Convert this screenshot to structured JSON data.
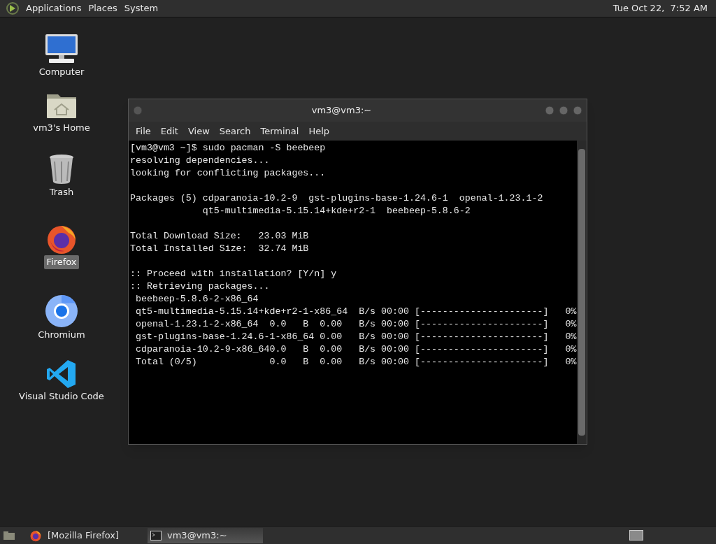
{
  "top_panel": {
    "menus": [
      "Applications",
      "Places",
      "System"
    ],
    "clock": "Tue Oct 22,  7:52 AM"
  },
  "desktop_icons": [
    {
      "kind": "computer",
      "label": "Computer",
      "selected": false
    },
    {
      "kind": "home",
      "label": "vm3's Home",
      "selected": false
    },
    {
      "kind": "trash",
      "label": "Trash",
      "selected": false
    },
    {
      "kind": "firefox",
      "label": "Firefox",
      "selected": true
    },
    {
      "kind": "chromium",
      "label": "Chromium",
      "selected": false
    },
    {
      "kind": "vscode",
      "label": "Visual Studio Code",
      "selected": false
    }
  ],
  "terminal": {
    "title": "vm3@vm3:~",
    "menu": [
      "File",
      "Edit",
      "View",
      "Search",
      "Terminal",
      "Help"
    ],
    "blocks": [
      [
        "[vm3@vm3 ~]$ sudo pacman -S beebeep",
        "resolving dependencies...",
        "looking for conflicting packages..."
      ],
      [
        "Packages (5) cdparanoia-10.2-9  gst-plugins-base-1.24.6-1  openal-1.23.1-2",
        "             qt5-multimedia-5.15.14+kde+r2-1  beebeep-5.8.6-2"
      ],
      [
        "Total Download Size:   23.03 MiB",
        "Total Installed Size:  32.74 MiB"
      ],
      [
        ":: Proceed with installation? [Y/n] y",
        ":: Retrieving packages...",
        " beebeep-5.8.6-2-x86_64",
        " qt5-multimedia-5.15.14+kde+r2-1-x86_64  B/s 00:00 [----------------------]   0%",
        " openal-1.23.1-2-x86_64  0.0   B  0.00   B/s 00:00 [----------------------]   0%",
        " gst-plugins-base-1.24.6-1-x86_64 0.00   B/s 00:00 [----------------------]   0%",
        " cdparanoia-10.2-9-x86_640.0   B  0.00   B/s 00:00 [----------------------]   0%",
        " Total (0/5)             0.0   B  0.00   B/s 00:00 [----------------------]   0%"
      ]
    ]
  },
  "taskbar": [
    {
      "kind": "firefox",
      "label": "[Mozilla Firefox]",
      "selected": false
    },
    {
      "kind": "terminal",
      "label": "vm3@vm3:~",
      "selected": true
    }
  ]
}
